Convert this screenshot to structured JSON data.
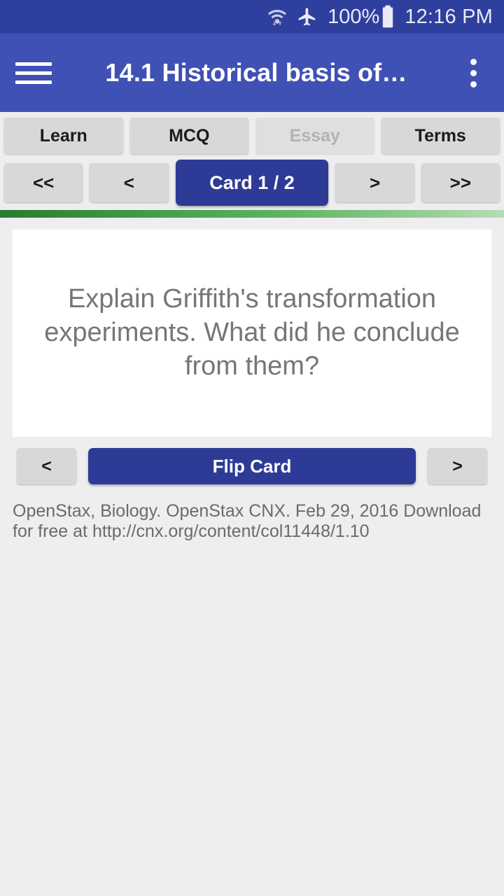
{
  "status_bar": {
    "wifi_icon": "wifi-with-transfer-arrows-icon",
    "airplane_icon": "airplane-mode-icon",
    "battery_percent": "100%",
    "battery_icon": "battery-full-icon",
    "time": "12:16 PM",
    "background_color": "#2f3f9e"
  },
  "app_bar": {
    "menu_icon": "hamburger-menu-icon",
    "title": "14.1 Historical basis of…",
    "overflow_icon": "overflow-menu-icon",
    "background_color": "#3f51b5"
  },
  "tabs": [
    {
      "label": "Learn",
      "enabled": true,
      "selected": false
    },
    {
      "label": "MCQ",
      "enabled": true,
      "selected": false
    },
    {
      "label": "Essay",
      "enabled": false,
      "selected": false
    },
    {
      "label": "Terms",
      "enabled": true,
      "selected": false
    }
  ],
  "nav": {
    "first_label": "<<",
    "prev_label": "<",
    "counter_label": "Card 1 / 2",
    "next_label": ">",
    "last_label": ">>",
    "counter_color": "#2e3b96"
  },
  "progress": {
    "start_color": "#2b7a31",
    "end_color": "#b7dcb6"
  },
  "card": {
    "question": "Explain Griffith's transformation experiments. What did he conclude from them?",
    "text_color": "#767676",
    "background_color": "#ffffff"
  },
  "flip_row": {
    "prev_label": "<",
    "flip_label": "Flip Card",
    "next_label": ">",
    "flip_color": "#2e3b96"
  },
  "attribution": {
    "text": "OpenStax, Biology. OpenStax CNX. Feb 29, 2016 Download for free at http://cnx.org/content/col11448/1.10"
  }
}
